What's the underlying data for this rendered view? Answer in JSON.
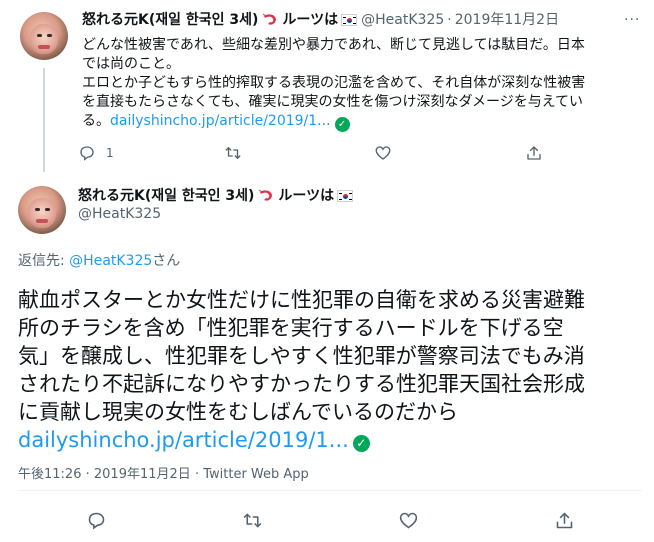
{
  "tweet1": {
    "display_name": "怒れる元K(재일 한국인 3세)",
    "suffix_text": "ルーツは",
    "handle": "@HeatK325",
    "separator": "·",
    "date": "2019年11月2日",
    "more": "···",
    "text_line1": "どんな性被害であれ、些細な差別や暴力であれ、断じて見逃しては駄目だ。日本",
    "text_line2": "では尚のこと。",
    "text_line3": "エロとか子どもすら性的搾取する表現の氾濫を含めて、それ自体が深刻な性被害",
    "text_line4": "を直接もたらさなくても、確実に現実の女性を傷つけ深刻なダメージを与えてい",
    "text_line5_prefix": "る。",
    "link": "dailyshincho.jp/article/2019/1...",
    "verified_mark": "✓",
    "reply_count": "1"
  },
  "tweet2": {
    "display_name": "怒れる元K(재일 한국인 3세)",
    "suffix_text": "ルーツは",
    "handle": "@HeatK325",
    "reply_to_label": "返信先:",
    "reply_to_mention": "@HeatK325",
    "reply_to_suffix": "さん",
    "body_line1": "献血ポスターとか女性だけに性犯罪の自衛を求める災害避難",
    "body_line2": "所のチラシを含め「性犯罪を実行するハードルを下げる空",
    "body_line3": "気」を醸成し、性犯罪をしやすく性犯罪が警察司法でもみ消",
    "body_line4": "されたり不起訴になりやすかったりする性犯罪天国社会形成",
    "body_line5": "に貢献し現実の女性をむしばんでいるのだから",
    "link": "dailyshincho.jp/article/2019/1...",
    "verified_mark": "✓",
    "time": "午後11:26",
    "separator": "·",
    "date": "2019年11月2日",
    "source": "Twitter Web App"
  },
  "icons": {
    "reply": "reply-icon",
    "retweet": "retweet-icon",
    "like": "heart-icon",
    "share": "share-icon",
    "flag": "south-korea-flag-icon",
    "shrimp": "shrimp-emoji-icon"
  },
  "colors": {
    "link": "#1d9bf0",
    "secondary_text": "#536471",
    "verified": "#00a85a",
    "thread_line": "#cfd9de"
  }
}
